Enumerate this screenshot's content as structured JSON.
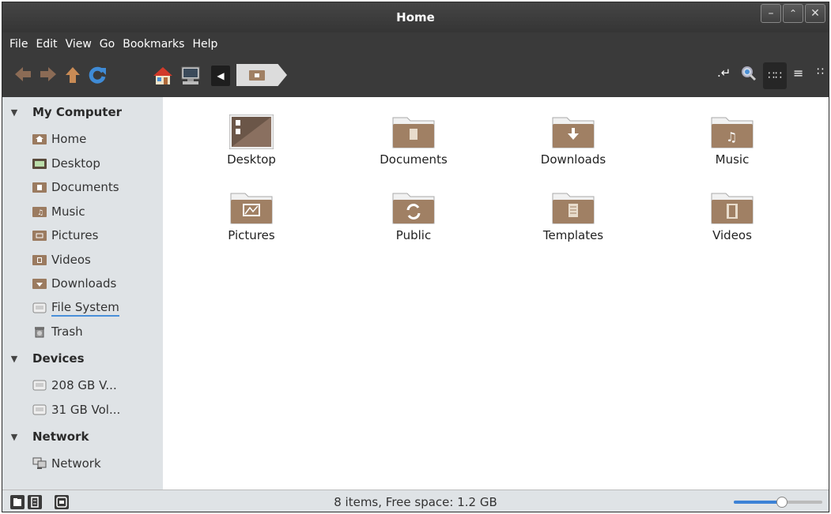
{
  "window": {
    "title": "Home"
  },
  "menubar": {
    "items": [
      "File",
      "Edit",
      "View",
      "Go",
      "Bookmarks",
      "Help"
    ]
  },
  "toolbar": {
    "buttons": [
      "back-icon",
      "forward-icon",
      "up-icon",
      "reload-icon",
      "home-icon",
      "computer-icon",
      "breadcrumb-left-icon"
    ],
    "right_buttons": [
      "location-toggle-icon",
      "search-icon",
      "icon-view-icon",
      "list-view-icon",
      "compact-view-icon"
    ]
  },
  "sidebar": {
    "sections": [
      {
        "label": "My Computer",
        "items": [
          {
            "label": "Home",
            "icon": "home-folder-icon"
          },
          {
            "label": "Desktop",
            "icon": "desktop-folder-icon"
          },
          {
            "label": "Documents",
            "icon": "documents-folder-icon"
          },
          {
            "label": "Music",
            "icon": "music-folder-icon"
          },
          {
            "label": "Pictures",
            "icon": "pictures-folder-icon"
          },
          {
            "label": "Videos",
            "icon": "videos-folder-icon"
          },
          {
            "label": "Downloads",
            "icon": "downloads-folder-icon"
          },
          {
            "label": "File System",
            "icon": "drive-icon"
          },
          {
            "label": "Trash",
            "icon": "trash-icon"
          }
        ]
      },
      {
        "label": "Devices",
        "items": [
          {
            "label": "208 GB V...",
            "icon": "drive-icon"
          },
          {
            "label": "31 GB Vol...",
            "icon": "drive-icon"
          }
        ]
      },
      {
        "label": "Network",
        "items": [
          {
            "label": "Network",
            "icon": "network-icon"
          }
        ]
      }
    ]
  },
  "main": {
    "items": [
      {
        "label": "Desktop",
        "icon": "desktop-icon"
      },
      {
        "label": "Documents",
        "icon": "documents-folder-icon"
      },
      {
        "label": "Downloads",
        "icon": "downloads-folder-icon"
      },
      {
        "label": "Music",
        "icon": "music-folder-icon"
      },
      {
        "label": "Pictures",
        "icon": "pictures-folder-icon"
      },
      {
        "label": "Public",
        "icon": "public-folder-icon"
      },
      {
        "label": "Templates",
        "icon": "templates-folder-icon"
      },
      {
        "label": "Videos",
        "icon": "videos-folder-icon"
      }
    ]
  },
  "statusbar": {
    "text": "8 items, Free space: 1.2 GB",
    "zoom_fraction": 0.55
  },
  "colors": {
    "accent": "#3d82d6",
    "folder": "#a08064",
    "toolbar_bg": "#3a3a3a",
    "sidebar_bg": "#dfe3e6"
  }
}
